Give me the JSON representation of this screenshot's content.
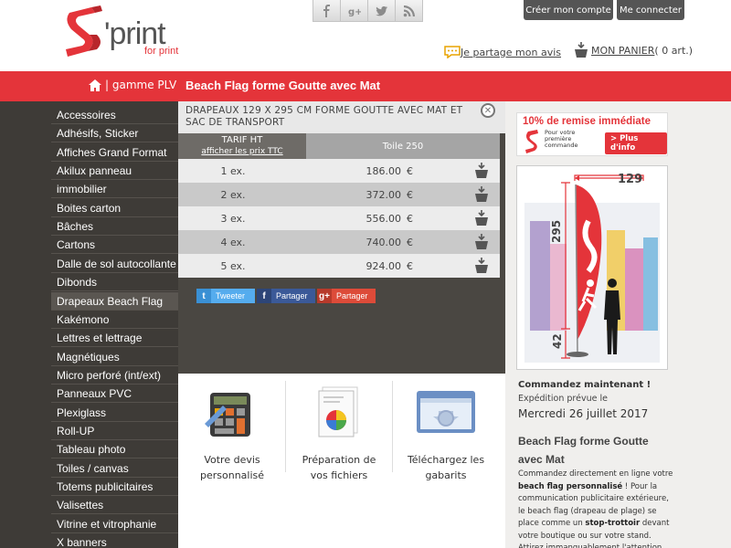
{
  "brand": {
    "logo_main": "'print",
    "logo_sub": "for print",
    "red": "#e4343a"
  },
  "header": {
    "social": [
      {
        "name": "facebook-icon"
      },
      {
        "name": "google-plus-icon"
      },
      {
        "name": "twitter-icon"
      },
      {
        "name": "rss-icon"
      }
    ],
    "create_account": "Créer mon compte",
    "login": "Me connecter",
    "avis": "Je partage mon avis",
    "panier_label": "MON PANIER",
    "panier_count": "( 0 art.)"
  },
  "breadcrumb": {
    "label": "| gamme PLV"
  },
  "page_title": "Beach Flag forme Goutte avec Mat",
  "sidebar": {
    "items": [
      "Accessoires",
      "Adhésifs, Sticker",
      "Affiches Grand Format",
      "Akilux panneau",
      "immobilier",
      "Boites carton",
      "Bâches",
      "Cartons",
      "Dalle de sol autocollante",
      "Dibonds",
      "Drapeaux Beach Flag",
      "Kakémono",
      "Lettres et lettrage",
      "Magnétiques",
      "Micro perforé (int/ext)",
      "Panneaux PVC",
      "Plexiglass",
      "Roll-UP",
      "Tableau photo",
      "Toiles / canvas",
      "Totems publicitaires",
      "Valisettes",
      "Vitrine et vitrophanie",
      "X banners"
    ],
    "active_index": 10
  },
  "panel": {
    "title": "DRAPEAUX 129 X 295 CM FORME GOUTTE AVEC MAT ET SAC DE TRANSPORT",
    "tarif_label": "TARIF HT",
    "ttc_link": "afficher les prix TTC",
    "column_label": "Toile 250",
    "currency": "€",
    "rows": [
      {
        "qty": "1 ex.",
        "price": "186.00"
      },
      {
        "qty": "2 ex.",
        "price": "372.00"
      },
      {
        "qty": "3 ex.",
        "price": "556.00"
      },
      {
        "qty": "4 ex.",
        "price": "740.00"
      },
      {
        "qty": "5 ex.",
        "price": "924.00"
      }
    ]
  },
  "share": {
    "tweet": "Tweeter",
    "fb": "Partager",
    "gplus": "Partager"
  },
  "features": {
    "devis_1": "Votre devis",
    "devis_2": "personnalisé",
    "prep_1": "Préparation de",
    "prep_2": "vos fichiers",
    "gab_1": "Téléchargez les",
    "gab_2": "gabarits"
  },
  "promo": {
    "title": "10% de remise immédiate",
    "sub1": "Pour votre",
    "sub2": "première",
    "sub3": "commande",
    "btn": "> Plus d'info"
  },
  "flag": {
    "width": "129",
    "height": "295",
    "pole": "42"
  },
  "order": {
    "title": "Commandez maintenant !",
    "expedition": "Expédition prévue le",
    "date": "Mercredi 26 juillet 2017"
  },
  "description": {
    "title": "Beach Flag forme Goutte avec Mat",
    "p1": "Commandez directement en ligne votre ",
    "b1": "beach flag personnalisé",
    "p2": " ! Pour la communication publicitaire extérieure, le beach flag (drapeau de plage) se place comme un ",
    "b2": "stop-trottoir",
    "p3": " devant votre boutique ou sur votre stand. Attirez immanquablement l'attention des"
  }
}
